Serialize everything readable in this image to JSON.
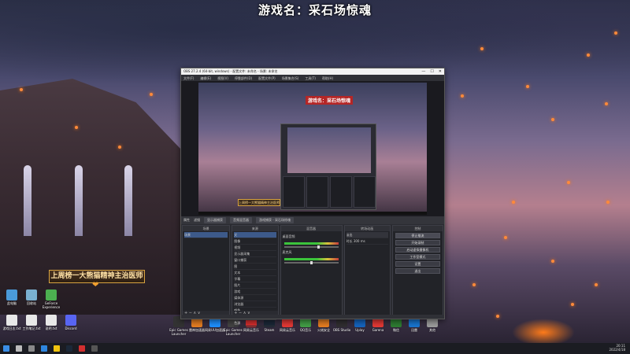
{
  "overlay": {
    "game_title": "游戏名：采石场惊魂",
    "banner": "上周榜一大熊猫精神主治医师",
    "heart": "❤"
  },
  "obs": {
    "title": "OBS 27.2.4 (64-bit, windows) - 配置文件: 未命名 - 场景: 未命名",
    "menu": [
      "文件(F)",
      "编辑(E)",
      "视图(V)",
      "停靠部件(D)",
      "配置文件(P)",
      "场景集合(S)",
      "工具(T)",
      "帮助(H)"
    ],
    "window_buttons": [
      "—",
      "☐",
      "✕"
    ],
    "preview_title": "游戏名：采石场惊魂",
    "preview_banner": "上周榜一大熊猫精神主治医师",
    "toolbar": [
      "属性",
      "滤镜",
      "显示器捕获",
      "音频混音器",
      "游戏捕获 - 采石场惊魂"
    ],
    "docks": {
      "scenes": {
        "title": "场景",
        "items": [
          "场景"
        ]
      },
      "sources": {
        "title": "来源",
        "items": [
          "文",
          "图像",
          "视频",
          "显示器采集",
          "窗口捕获",
          "图",
          "文本",
          "字幕",
          "图片",
          "游戏",
          "媒体源",
          "浏览器",
          "颜色",
          "音频",
          "色源"
        ]
      },
      "mixer": {
        "title": "混音器",
        "channels": [
          {
            "name": "桌面音频",
            "level": 0.62
          },
          {
            "name": "麦克风",
            "level": 0.48
          }
        ]
      },
      "transitions": {
        "title": "转场动画",
        "mode": "淡出",
        "duration_label": "时长",
        "duration": "300 ms"
      },
      "controls": {
        "title": "控制",
        "buttons": [
          "停止推流",
          "开始录制",
          "启动虚拟摄像机",
          "工作室模式",
          "设置",
          "退出"
        ]
      }
    },
    "footer_glyphs": "+ − ∧ ∨"
  },
  "desktop_icons": [
    {
      "label": "此电脑",
      "color": "#4a9ad9"
    },
    {
      "label": "回收站",
      "color": "#7ab0d0"
    },
    {
      "label": "GeForce Experience",
      "color": "#4caf50"
    },
    {
      "label": "游戏日志.txt",
      "color": "#e8e8e8"
    },
    {
      "label": "工作笔记.txt",
      "color": "#e8e8e8"
    },
    {
      "label": "说明.txt",
      "color": "#e8e8e8"
    },
    {
      "label": "Discord",
      "color": "#5865f2"
    }
  ],
  "desktop_apps": [
    {
      "label": "Epic Games Launcher",
      "color": "#333"
    },
    {
      "label": "雷神加速器",
      "color": "#e67e22"
    },
    {
      "label": "网易UU加速器",
      "color": "#1e90ff"
    },
    {
      "label": "Epic Games Launcher",
      "color": "#444"
    },
    {
      "label": "网易云音乐",
      "color": "#d32f2f"
    },
    {
      "label": "Steam",
      "color": "#1b2838"
    },
    {
      "label": "网易云音乐",
      "color": "#e53935"
    },
    {
      "label": "QQ音乐",
      "color": "#43a047"
    },
    {
      "label": "火绒安全",
      "color": "#e67e22"
    },
    {
      "label": "OBS Studio",
      "color": "#302e31"
    },
    {
      "label": "Uplay",
      "color": "#1565c0"
    },
    {
      "label": "Garena",
      "color": "#e53935"
    },
    {
      "label": "微信",
      "color": "#2e7d32"
    },
    {
      "label": "迅雷",
      "color": "#1976d2"
    },
    {
      "label": "其他",
      "color": "#9e9e9e"
    }
  ],
  "taskbar": {
    "icons": [
      "windows-icon",
      "search-icon",
      "task-view-icon",
      "edge-icon",
      "explorer-icon",
      "steam-icon",
      "netease-icon",
      "obs-icon"
    ],
    "time": "20:11",
    "date": "2022/4/18"
  }
}
